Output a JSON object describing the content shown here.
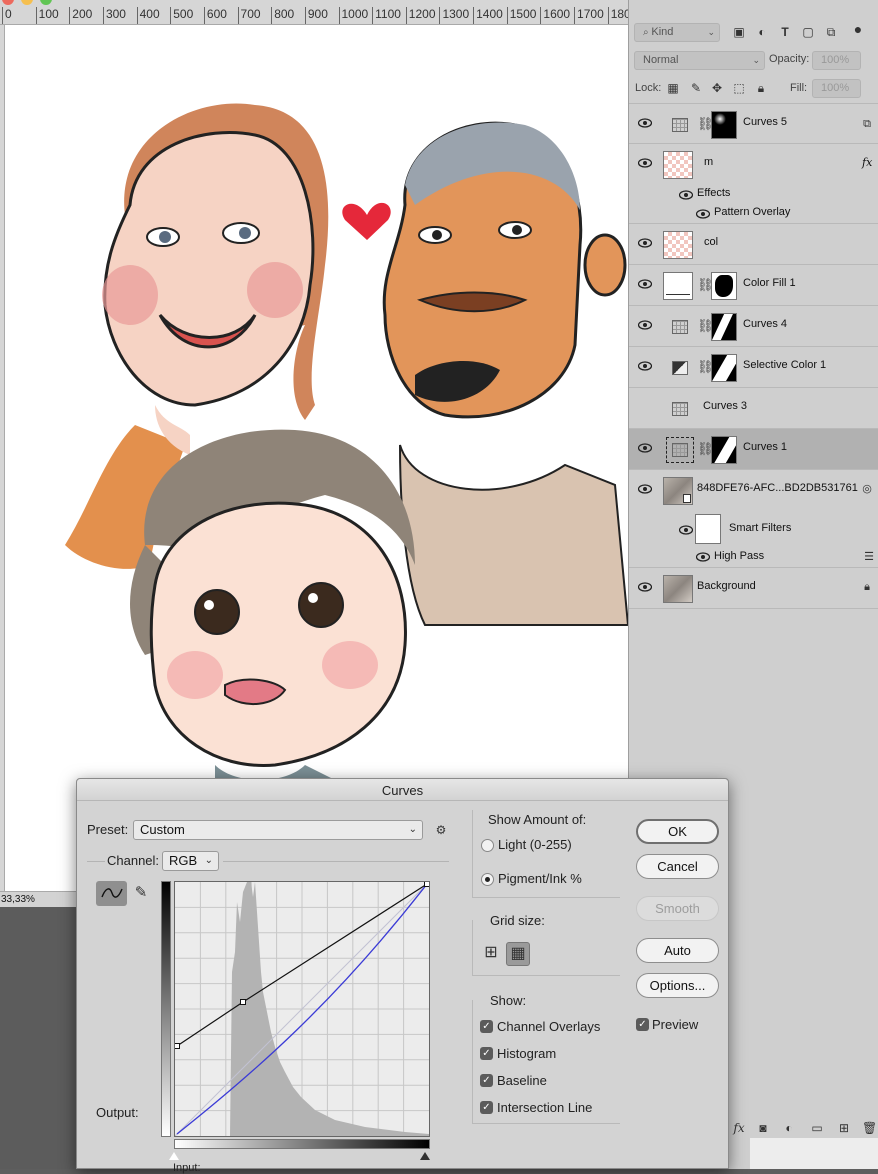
{
  "ruler": {
    "marks": [
      "0",
      "100",
      "200",
      "300",
      "400",
      "500",
      "600",
      "700",
      "800",
      "900",
      "1000",
      "1100",
      "1200",
      "1300",
      "1400",
      "1500",
      "1600",
      "1700",
      "180"
    ]
  },
  "status": {
    "zoom": "33,33%"
  },
  "layers_panel": {
    "filter_kind": "Kind",
    "blend_mode": "Normal",
    "opacity_label": "Opacity:",
    "opacity_value": "100%",
    "lock_label": "Lock:",
    "fill_label": "Fill:",
    "fill_value": "100%",
    "layers": [
      {
        "name": "Curves 5"
      },
      {
        "name": "m",
        "fx": "fx",
        "effects_label": "Effects",
        "effect": "Pattern Overlay"
      },
      {
        "name": "col"
      },
      {
        "name": "Color Fill 1"
      },
      {
        "name": "Curves 4"
      },
      {
        "name": "Selective Color 1"
      },
      {
        "name": "Curves 3"
      },
      {
        "name": "Curves 1"
      },
      {
        "name": "848DFE76-AFC...BD2DB531761",
        "smart_filters": "Smart Filters",
        "filter": "High Pass"
      },
      {
        "name": "Background"
      }
    ]
  },
  "curves_dialog": {
    "title": "Curves",
    "preset_label": "Preset:",
    "preset_value": "Custom",
    "channel_label": "Channel:",
    "channel_value": "RGB",
    "output_label": "Output:",
    "input_label": "Input:",
    "show_amount_label": "Show Amount of:",
    "light_option": "Light  (0-255)",
    "pigment_option": "Pigment/Ink %",
    "grid_size_label": "Grid size:",
    "show_label": "Show:",
    "show_options": [
      "Channel Overlays",
      "Histogram",
      "Baseline",
      "Intersection Line"
    ],
    "buttons": {
      "ok": "OK",
      "cancel": "Cancel",
      "smooth": "Smooth",
      "auto": "Auto",
      "options": "Options..."
    },
    "preview_label": "Preview"
  },
  "colors": {
    "accent_curve": "#3b3bd6",
    "selected_row": "#b1b1b1"
  }
}
